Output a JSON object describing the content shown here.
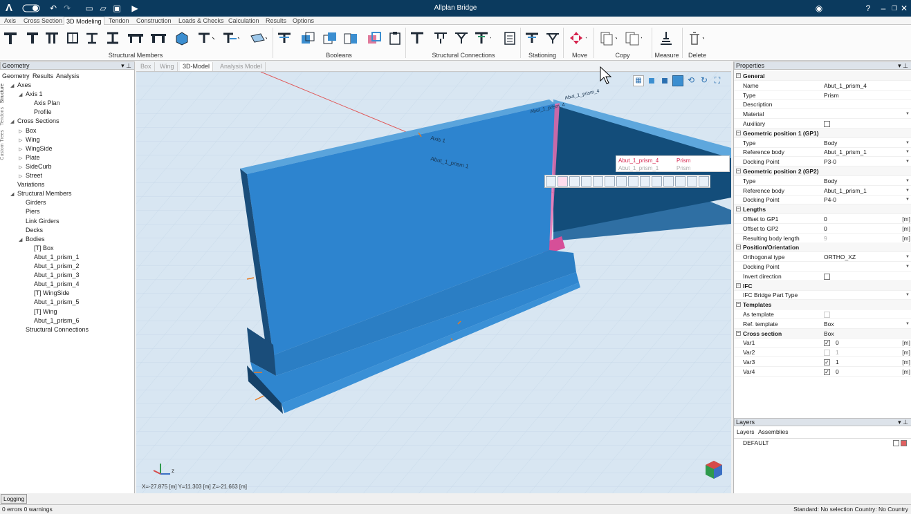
{
  "app": {
    "title": "Allplan Bridge"
  },
  "menu": [
    "Axis",
    "Cross Section",
    "3D Modeling",
    "Tendon",
    "Construction",
    "Loads & Checks",
    "Calculation",
    "Results",
    "Options"
  ],
  "ribbon": {
    "groups": [
      "Structural Members",
      "Booleans",
      "Structural Connections",
      "Stationing",
      "Move",
      "Copy",
      "Measure",
      "Delete"
    ]
  },
  "left_panel": {
    "title": "Geometry",
    "tabs": [
      "Geometry",
      "Results",
      "Analysis"
    ],
    "side_tabs": [
      "Structure",
      "Tendons",
      "Custom Trees"
    ],
    "tree": [
      {
        "label": "Axes",
        "level": 0,
        "open": true
      },
      {
        "label": "Axis 1",
        "level": 1,
        "open": true
      },
      {
        "label": "Axis Plan",
        "level": 2
      },
      {
        "label": "Profile",
        "level": 2
      },
      {
        "label": "Cross Sections",
        "level": 0,
        "open": true
      },
      {
        "label": "Box",
        "level": 1,
        "closed": true
      },
      {
        "label": "Wing",
        "level": 1,
        "closed": true
      },
      {
        "label": "WingSide",
        "level": 1,
        "closed": true
      },
      {
        "label": "Plate",
        "level": 1,
        "closed": true
      },
      {
        "label": "SideCurb",
        "level": 1,
        "closed": true
      },
      {
        "label": "Street",
        "level": 1,
        "closed": true
      },
      {
        "label": "Variations",
        "level": 0
      },
      {
        "label": "Structural Members",
        "level": 0,
        "open": true
      },
      {
        "label": "Girders",
        "level": 1
      },
      {
        "label": "Piers",
        "level": 1
      },
      {
        "label": "Link Girders",
        "level": 1
      },
      {
        "label": "Decks",
        "level": 1
      },
      {
        "label": "Bodies",
        "level": 1,
        "open": true
      },
      {
        "label": "[T] Box",
        "level": 2
      },
      {
        "label": "Abut_1_prism_1",
        "level": 2
      },
      {
        "label": "Abut_1_prism_2",
        "level": 2
      },
      {
        "label": "Abut_1_prism_3",
        "level": 2
      },
      {
        "label": "Abut_1_prism_4",
        "level": 2
      },
      {
        "label": "[T] WingSide",
        "level": 2
      },
      {
        "label": "Abut_1_prism_5",
        "level": 2
      },
      {
        "label": "[T] Wing",
        "level": 2
      },
      {
        "label": "Abut_1_prism_6",
        "level": 2
      },
      {
        "label": "Structural Connections",
        "level": 1
      }
    ]
  },
  "view": {
    "tabs": [
      "Box",
      "Wing",
      "3D-Model",
      "Analysis Model"
    ],
    "active_tab": "3D-Model",
    "labels": {
      "axis": "Axis 1",
      "prism_name1": "Abut_1_prism 1",
      "prism_top": "Abut_1_prism_4",
      "prism_top2": "Abut_1_prism_4"
    },
    "popup": {
      "row1_name": "Abut_1_prism_4",
      "row1_type": "Prism",
      "row2_name": "Abut_1_prism_1",
      "row2_type": "Prism"
    },
    "coordinates": "X=-27.875 [m] Y=11.303 [m] Z=-21.663 [m]",
    "axis_z": "z"
  },
  "properties": {
    "title": "Properties",
    "rows": [
      {
        "sec": "General"
      },
      {
        "k": "Name",
        "v": "Abut_1_prism_4"
      },
      {
        "k": "Type",
        "v": "Prism"
      },
      {
        "k": "Description",
        "v": ""
      },
      {
        "k": "Material",
        "v": "",
        "dd": true
      },
      {
        "k": "Auxiliary",
        "chk": false
      },
      {
        "sec": "Geometric position 1 (GP1)"
      },
      {
        "k": "Type",
        "v": "Body",
        "dd": true
      },
      {
        "k": "Reference body",
        "v": "Abut_1_prism_1",
        "dd": true
      },
      {
        "k": "Docking Point",
        "v": "P3-0",
        "dd": true
      },
      {
        "sec": "Geometric position 2 (GP2)"
      },
      {
        "k": "Type",
        "v": "Body",
        "dd": true
      },
      {
        "k": "Reference body",
        "v": "Abut_1_prism_1",
        "dd": true
      },
      {
        "k": "Docking Point",
        "v": "P4-0",
        "dd": true
      },
      {
        "sec": "Lengths"
      },
      {
        "k": "Offset to GP1",
        "v": "0",
        "u": "[m]"
      },
      {
        "k": "Offset to GP2",
        "v": "0",
        "u": "[m]"
      },
      {
        "k": "Resulting body length",
        "v": "9",
        "u": "[m]",
        "grey": true
      },
      {
        "sec": "Position/Orientation"
      },
      {
        "k": "Orthogonal type",
        "v": "ORTHO_XZ",
        "dd": true
      },
      {
        "k": "Docking Point",
        "v": "",
        "dd": true
      },
      {
        "k": "Invert direction",
        "chk": false
      },
      {
        "sec": "IFC"
      },
      {
        "k": "IFC Bridge Part Type",
        "v": "",
        "dd": true
      },
      {
        "sec": "Templates"
      },
      {
        "k": "As template",
        "chk": false,
        "grey": true
      },
      {
        "k": "Ref. template",
        "v": "Box",
        "dd": true
      },
      {
        "sec": "Cross section",
        "v": "Box"
      },
      {
        "k": "Var1",
        "chk": true,
        "v": "0",
        "u": "[m]"
      },
      {
        "k": "Var2",
        "chk": false,
        "v": "1",
        "u": "[m]",
        "grey": true
      },
      {
        "k": "Var3",
        "chk": true,
        "v": "1",
        "u": "[m]"
      },
      {
        "k": "Var4",
        "chk": true,
        "v": "0",
        "u": "[m]"
      }
    ]
  },
  "layers": {
    "title": "Layers",
    "tabs": [
      "Layers",
      "Assemblies"
    ],
    "items": [
      "DEFAULT"
    ]
  },
  "status": {
    "logging": "Logging",
    "left": "0 errors 0 warnings",
    "right": "Standard: No selection Country: No Country"
  }
}
